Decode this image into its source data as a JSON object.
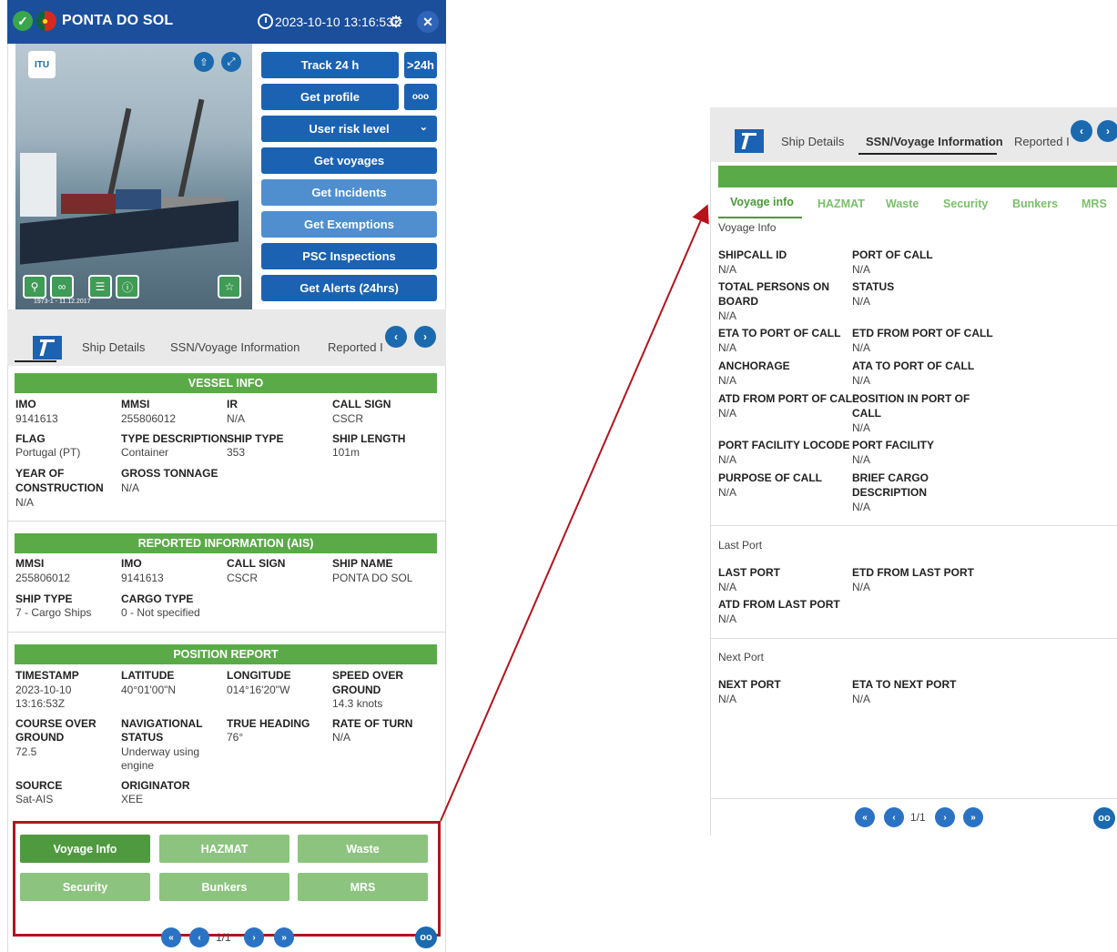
{
  "header": {
    "ship_name": "PONTA DO SOL",
    "timestamp": "2023-10-10 13:16:53Z",
    "ok_icon_glyph": "✓",
    "close_glyph": "✕",
    "gear_glyph": "⚙"
  },
  "photo": {
    "logo_text": "ITU",
    "caption": "1973-1 - 11.12.2017"
  },
  "actions": {
    "track": "Track 24 h",
    "track_more": ">24h",
    "get_profile": "Get profile",
    "profile_more": "ooo",
    "user_risk": "User risk level",
    "get_voyages": "Get voyages",
    "get_incidents": "Get Incidents",
    "get_exemptions": "Get Exemptions",
    "psc_inspections": "PSC Inspections",
    "get_alerts": "Get Alerts (24hrs)"
  },
  "tabs": {
    "ship_details": "Ship Details",
    "ssn_voyage": "SSN/Voyage Information",
    "reported": "Reported I",
    "prev": "‹",
    "next": "›"
  },
  "vessel_info": {
    "header": "VESSEL INFO",
    "fields": [
      {
        "label": "IMO",
        "value": "9141613"
      },
      {
        "label": "MMSI",
        "value": "255806012"
      },
      {
        "label": "IR",
        "value": "N/A"
      },
      {
        "label": "CALL SIGN",
        "value": "CSCR"
      },
      {
        "label": "FLAG",
        "value": "Portugal (PT)"
      },
      {
        "label": "TYPE DESCRIPTION",
        "value": "Container"
      },
      {
        "label": "SHIP TYPE",
        "value": "353"
      },
      {
        "label": "SHIP LENGTH",
        "value": "101m"
      },
      {
        "label": "YEAR OF",
        "label2": "CONSTRUCTION",
        "value": "N/A"
      },
      {
        "label": "GROSS TONNAGE",
        "value": "N/A"
      }
    ]
  },
  "ais_info": {
    "header": "REPORTED INFORMATION (AIS)",
    "fields": [
      {
        "label": "MMSI",
        "value": "255806012"
      },
      {
        "label": "IMO",
        "value": "9141613"
      },
      {
        "label": "CALL SIGN",
        "value": "CSCR"
      },
      {
        "label": "SHIP NAME",
        "value": "PONTA DO SOL"
      },
      {
        "label": "SHIP TYPE",
        "value": "7 - Cargo Ships"
      },
      {
        "label": "CARGO TYPE",
        "value": "0 - Not specified"
      }
    ]
  },
  "position_report": {
    "header": "POSITION REPORT",
    "timestamp_label": "TIMESTAMP",
    "timestamp_value1": "2023-10-10",
    "timestamp_value2": "13:16:53Z",
    "latitude_label": "LATITUDE",
    "latitude_value": "40°01'00\"N",
    "longitude_label": "LONGITUDE",
    "longitude_value": "014°16'20\"W",
    "speed_label1": "SPEED OVER",
    "speed_label2": "GROUND",
    "speed_value": "14.3 knots",
    "course_label1": "COURSE OVER",
    "course_label2": "GROUND",
    "course_value": "72.5",
    "nav_label1": "NAVIGATIONAL",
    "nav_label2": "STATUS",
    "nav_value1": "Underway using",
    "nav_value2": "engine",
    "heading_label": "TRUE HEADING",
    "heading_value": "76°",
    "rot_label": "RATE OF TURN",
    "rot_value": "N/A",
    "source_label": "SOURCE",
    "source_value": "Sat-AIS",
    "originator_label": "ORIGINATOR",
    "originator_value": "XEE"
  },
  "bottom_buttons": [
    "Voyage Info",
    "HAZMAT",
    "Waste",
    "Security",
    "Bunkers",
    "MRS"
  ],
  "pager": {
    "first": "«",
    "prev": "‹",
    "page": "1/1",
    "next": "›",
    "last": "»",
    "binoculars": "oo"
  },
  "right_panel": {
    "subtabs": [
      "Voyage info",
      "HAZMAT",
      "Waste",
      "Security",
      "Bunkers",
      "MRS"
    ],
    "voyage_info_title": "Voyage Info",
    "last_port_title": "Last Port",
    "next_port_title": "Next Port",
    "voyage_fields": {
      "shipcall_id": {
        "label": "SHIPCALL ID",
        "value": "N/A"
      },
      "port_of_call": {
        "label": "PORT OF CALL",
        "value": "N/A"
      },
      "total_persons": {
        "label1": "TOTAL PERSONS ON",
        "label2": "BOARD",
        "value": "N/A"
      },
      "status": {
        "label": "STATUS",
        "value": "N/A"
      },
      "eta_port": {
        "label": "ETA TO PORT OF CALL",
        "value": "N/A"
      },
      "etd_port": {
        "label": "ETD FROM PORT OF CALL",
        "value": "N/A"
      },
      "anchorage": {
        "label": "ANCHORAGE",
        "value": "N/A"
      },
      "ata_port": {
        "label": "ATA TO PORT OF CALL",
        "value": "N/A"
      },
      "atd_port": {
        "label": "ATD FROM PORT OF CALL",
        "value": "N/A"
      },
      "position_port": {
        "label1": "POSITION IN PORT OF",
        "label2": "CALL",
        "value": "N/A"
      },
      "locode": {
        "label": "PORT FACILITY LOCODE",
        "value": "N/A"
      },
      "facility": {
        "label": "PORT FACILITY",
        "value": "N/A"
      },
      "purpose": {
        "label": "PURPOSE OF CALL",
        "value": "N/A"
      },
      "cargo": {
        "label1": "BRIEF CARGO",
        "label2": "DESCRIPTION",
        "value": "N/A"
      }
    },
    "last_port_fields": {
      "last_port": {
        "label": "LAST PORT",
        "value": "N/A"
      },
      "etd_last": {
        "label": "ETD FROM LAST PORT",
        "value": "N/A"
      },
      "atd_last": {
        "label": "ATD FROM LAST PORT",
        "value": "N/A"
      }
    },
    "next_port_fields": {
      "next_port": {
        "label": "NEXT PORT",
        "value": "N/A"
      },
      "eta_next": {
        "label": "ETA TO NEXT PORT",
        "value": "N/A"
      }
    }
  },
  "colors": {
    "header_blue": "#1b4f9c",
    "button_blue": "#1b62b3",
    "section_green": "#5aaa48",
    "highlight_red": "#b5141c"
  }
}
